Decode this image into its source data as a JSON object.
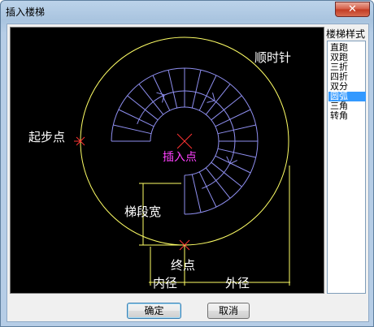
{
  "window": {
    "title": "插入楼梯",
    "close_label": "✕"
  },
  "preview": {
    "label_clockwise": "顺时针",
    "label_start": "起步点",
    "label_insert": "插入点",
    "label_stair_width": "梯段宽",
    "label_end": "终点",
    "label_inner_radius": "内径",
    "label_outer_radius": "外径",
    "colors": {
      "background": "#000000",
      "outer_circle": "#ffff66",
      "stair_lines": "#8f8ff0",
      "insert_marker": "#ff3333",
      "insert_label": "#ff40ff",
      "dimension": "#ffff66",
      "labels": "#ffffff"
    }
  },
  "stair_styles": {
    "label": "楼梯样式",
    "items": [
      "直跑",
      "双跑",
      "三折",
      "四折",
      "双分",
      "圆弧",
      "三角",
      "转角"
    ],
    "selected_index": 5
  },
  "buttons": {
    "ok_label": "确定",
    "cancel_label": "取消"
  }
}
